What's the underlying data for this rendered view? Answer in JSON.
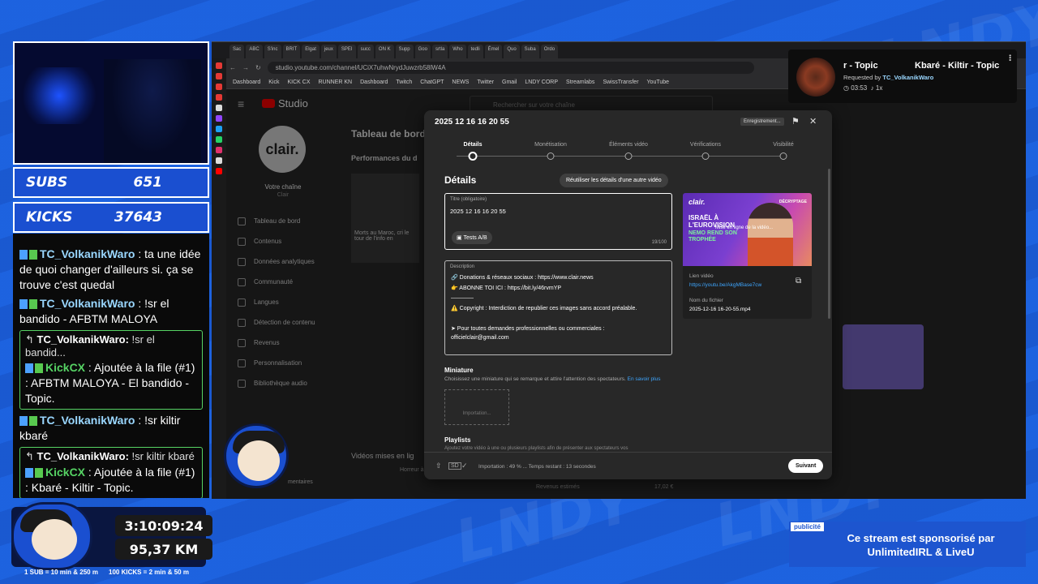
{
  "overlay": {
    "subs_label": "SUBS",
    "subs_value": "651",
    "kicks_label": "KICKS",
    "kicks_value": "37643",
    "timer": "3:10:09:24",
    "distance": "95,37 KM",
    "rule_subs": "1 SUB = 10 min & 250 m",
    "rule_kicks": "100 KICKS = 2 min & 50 m",
    "sponsor_tag": "publicité",
    "sponsor_text": "Ce stream est sponsorisé par UnlimitedIRL & LiveU"
  },
  "chat": {
    "msg1_user": "TC_VolkanikWaro",
    "msg1_text": " : ta une idée de quoi changer d'ailleurs si. ça se trouve c'est quedal",
    "msg2_user": "TC_VolkanikWaro",
    "msg2_text": " : !sr el bandido - AFBTM MALOYA",
    "reply1_top_user": "TC_VolkanikWaro:",
    "reply1_top_text": " !sr el bandid...",
    "reply1_bot": "KickCX",
    "reply1_text": " : Ajoutée à la file (#1) : AFBTM MALOYA - El bandido - Topic.",
    "msg3_user": "TC_VolkanikWaro",
    "msg3_text": " : !sr kiltir kbaré",
    "reply2_top_user": "TC_VolkanikWaro:",
    "reply2_top_text": " !sr kiltir kbaré",
    "reply2_bot": "KickCX",
    "reply2_text": " : Ajoutée à la file (#1) : Kbaré - Kiltir - Topic."
  },
  "browser": {
    "url": "studio.youtube.com/channel/UCiX7uhwNrydJuwzrb58lW4A",
    "bookmarks": [
      "Dashboard",
      "Kick",
      "KICK CX",
      "RUNNER KN",
      "Dashboard",
      "Twitch",
      "ChatGPT",
      "NEWS",
      "Twitter",
      "Gmail",
      "LNDY CORP",
      "Streamlabs",
      "SwissTransfer",
      "YouTube"
    ],
    "tabs": [
      "Sac",
      "ABC",
      "S'inc",
      "BRIT",
      "Elgat",
      "jeux",
      "SPEI",
      "succ",
      "ON K",
      "Supp",
      "Goo",
      "srtla",
      "Who",
      "tedli",
      "Émel",
      "Quo",
      "Suba",
      "Ordo"
    ]
  },
  "studio": {
    "logo": "Studio",
    "search_placeholder": "Rechercher sur votre chaîne",
    "channel_avatar": "clair.",
    "channel_label": "Votre chaîne",
    "channel_sub": "Clair",
    "dashboard_title": "Tableau de bord",
    "perf_title": "Performances du d",
    "card_text": "Morts au Maroc, cri le tour de l'info en",
    "nav": [
      "Tableau de bord",
      "Contenus",
      "Données analytiques",
      "Communauté",
      "Langues",
      "Détection de contenu",
      "Revenus",
      "Personnalisation",
      "Bibliothèque audio"
    ],
    "lower_title": "Vidéos mises en lig",
    "lower_item": "Horreur à Sydney",
    "lower_left": "mentaires",
    "revenue_label": "Revenus estimés",
    "revenue_value": "17,02 €"
  },
  "dialog": {
    "title": "2025 12 16 16 20 55",
    "badge": "Enregistrement...",
    "steps": [
      "Détails",
      "Monétisation",
      "Éléments vidéo",
      "Vérifications",
      "Visibilité"
    ],
    "section_title": "Détails",
    "reuse_button": "Réutiliser les détails d'une autre vidéo",
    "title_label": "Titre (obligatoire)",
    "title_value": "2025 12 16 16 20 55",
    "ab_button": "Tests A/B",
    "title_count": "19/100",
    "desc_label": "Description",
    "desc_lines": [
      "🔗 Donations & réseaux sociaux : https://www.clair.news",
      "👉 ABONNE TOI ICI : https://bit.ly/46rvmYP",
      "————",
      "⚠️ Copyright  : Interdiction de republier ces images sans accord préalable.",
      "➤ Pour toutes demandes professionnelles ou commerciales :",
      "officielclair@gmail.com"
    ],
    "thumb_brand": "clair.",
    "thumb_headline": "ISRAËL À L'EUROVISION",
    "thumb_sub": "NEMO REND SON TROPHÉE",
    "thumb_tag": "DÉCRYPTAGE",
    "thumb_upload": "Mise en ligne de la vidéo...",
    "link_label": "Lien vidéo",
    "link_value": "https://youtu.be/AkgMBase7cw",
    "file_label": "Nom du fichier",
    "file_value": "2025-12-16 16-20-55.mp4",
    "mini_title": "Miniature",
    "mini_desc": "Choisissez une miniature qui se remarque et attire l'attention des spectateurs.",
    "mini_link": "En savoir plus",
    "mini_box": "Importation...",
    "pl_title": "Playlists",
    "pl_desc": "Ajoutez votre vidéo à une ou plusieurs playlists afin de présenter aux spectateurs vos",
    "status": "Importation : 49 % ... Temps restant : 13 secondes",
    "next": "Suivant"
  },
  "music": {
    "title_left": "r - Topic",
    "title_right": "Kbaré - Kiltir - Topic",
    "requested_by": "Requested by ",
    "requester": "TC_VolkanikWaro",
    "duration": "03:53",
    "count": "1x"
  }
}
